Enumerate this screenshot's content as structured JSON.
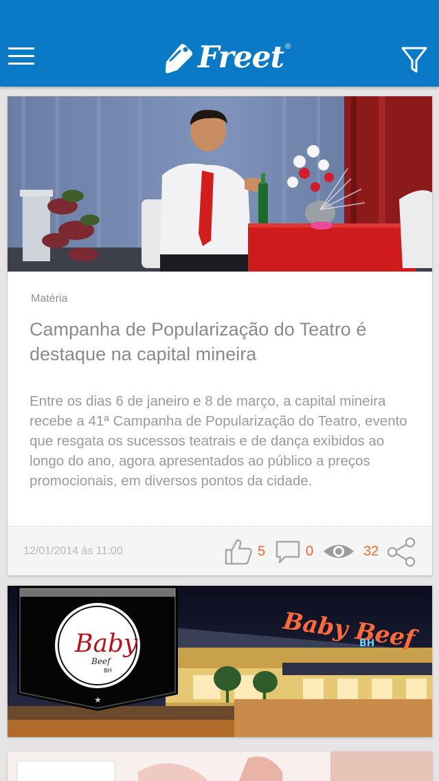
{
  "header": {
    "logo_text": "Freet",
    "logo_mark": "®",
    "menu_icon": "hamburger-menu-icon",
    "filter_icon": "filter-funnel-icon",
    "background": "#0a79c6"
  },
  "feed": {
    "items": [
      {
        "category": "Matéria",
        "title": "Campanha de Popularização do Teatro é destaque na capital mineira",
        "summary": "Entre os dias 6 de janeiro e 8 de março, a capital mineira recebe a 41ª  Campanha de Popularização do Teatro, evento que resgata os sucessos teatrais e de dança exibidos ao longo do ano, agora apresentados ao público a preços promocionais, em diversos pontos da cidade.",
        "date": "12/01/2014 às 11:00",
        "likes": "5",
        "comments": "0",
        "views": "32"
      },
      {
        "badge_text": "Baby",
        "badge_sub": "Beef",
        "badge_city": "BH",
        "sign_text": "Baby Beef",
        "sign_city": "BH"
      }
    ]
  },
  "colors": {
    "accent": "#e8692f",
    "muted_icon": "#a8a8a8"
  }
}
